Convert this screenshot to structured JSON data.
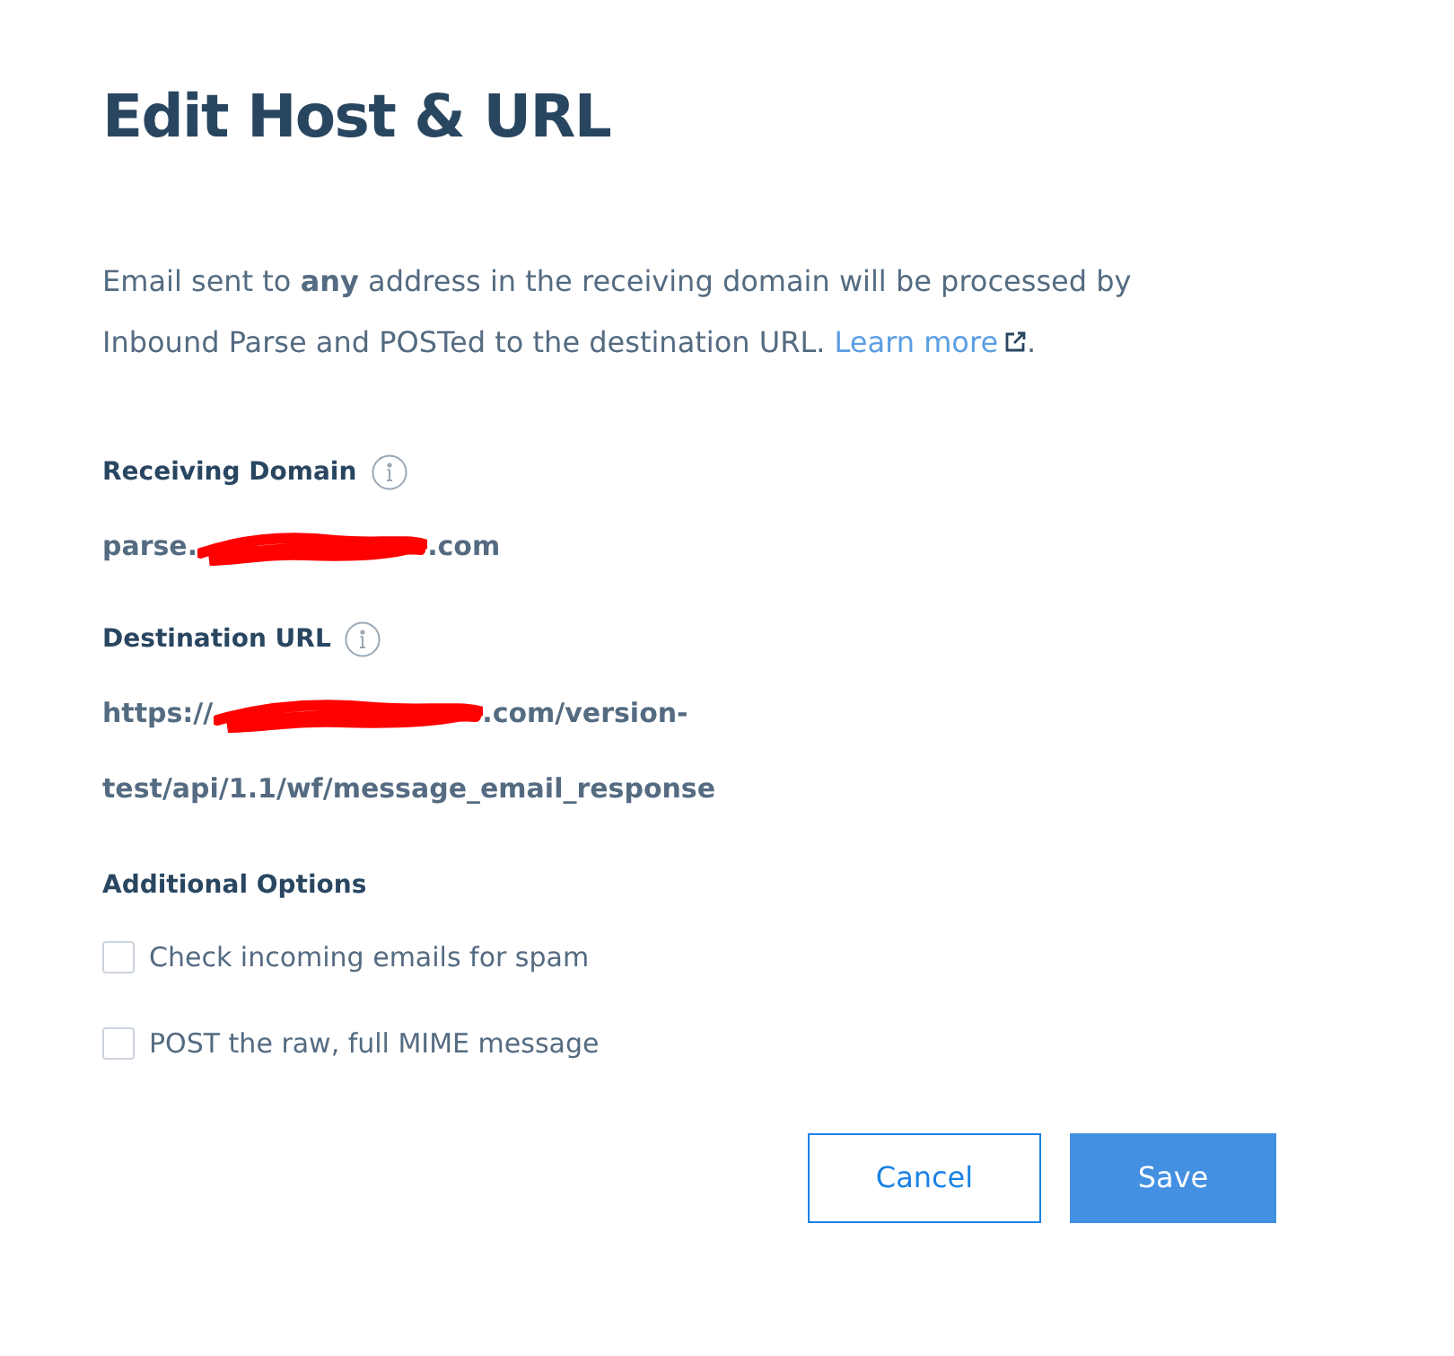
{
  "title": "Edit Host & URL",
  "description": {
    "text": "Email sent to **any** address in the receiving domain will be processed by Inbound Parse and POSTed to the destination URL.",
    "link": "Learn more",
    "after_link": "."
  },
  "fields": [
    {
      "label": "Receiving Domain",
      "lines": [
        {
          "before": "parse.",
          "redacted": true,
          "after": ".com"
        }
      ]
    },
    {
      "label": "Destination URL",
      "lines": [
        {
          "before": "https://",
          "redacted": true,
          "after": ".com/version-"
        },
        {
          "before": "test/api/1.1/wf/message_email_response",
          "redacted": false
        }
      ]
    }
  ],
  "options_heading": "Additional Options",
  "options": [
    {
      "label": "Check incoming emails for spam",
      "checked": false
    },
    {
      "label": "POST the raw, full MIME message",
      "checked": false
    }
  ],
  "buttons": [
    {
      "label": "Cancel",
      "kind": "secondary"
    },
    {
      "label": "Save",
      "kind": "primary"
    }
  ]
}
